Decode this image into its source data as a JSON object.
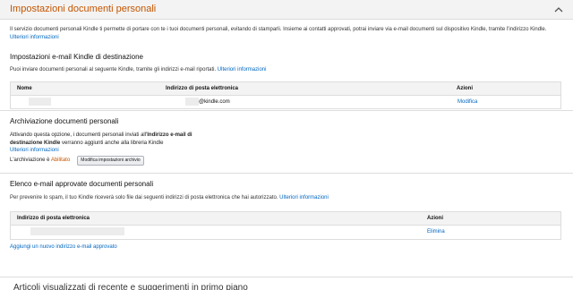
{
  "header": {
    "title": "Impostazioni documenti personali"
  },
  "intro": {
    "text": "Il servizio documenti personali Kindle ti permette di portare con te i tuoi documenti personali, evitando di stamparli. Insieme ai contatti approvati, potrai inviare via e-mail documenti sul dispositivo Kindle, tramite l'indirizzo Kindle.",
    "link": "Ulteriori informazioni"
  },
  "email_section": {
    "title": "Impostazioni e-mail Kindle di destinazione",
    "desc": "Puoi inviare documenti personali al seguente Kindle, tramite gli indirizzi e-mail riportati.",
    "link": "Ulteriori informazioni",
    "columns": [
      "Nome",
      "Indirizzo di posta elettronica",
      "Azioni"
    ],
    "rows": [
      {
        "email_suffix": "@kindle.com",
        "action": "Modifica"
      }
    ]
  },
  "archive_section": {
    "title": "Archiviazione documenti personali",
    "text_before": "Attivando questa opzione, i documenti personali inviati all'",
    "text_bold": "Indirizzo e-mail di destinazione Kindle",
    "text_after": " verranno aggiunti anche alla libreria Kindle",
    "link": "Ulteriori informazioni",
    "status_label": "L'archiviazione è ",
    "status_value": "Abilitato",
    "button": "Modifica impostazioni archivio"
  },
  "approved_section": {
    "title": "Elenco e-mail approvate documenti personali",
    "desc": "Per prevenire lo spam, il tuo Kindle riceverà solo file dai seguenti indirizzi di posta elettronica che hai autorizzato.",
    "link": "Ulteriori informazioni",
    "columns": [
      "Indirizzo di posta elettronica",
      "Azioni"
    ],
    "rows": [
      {
        "action": "Elimina"
      }
    ],
    "add_link": "Aggiungi un nuovo indirizzo e-mail approvato"
  },
  "next_panel": {
    "title": "Articoli visualizzati di recente e suggerimenti in primo piano"
  },
  "colors": {
    "accent": "#c45500",
    "link": "#0066c0",
    "header_bg": "#f3f3f3"
  }
}
